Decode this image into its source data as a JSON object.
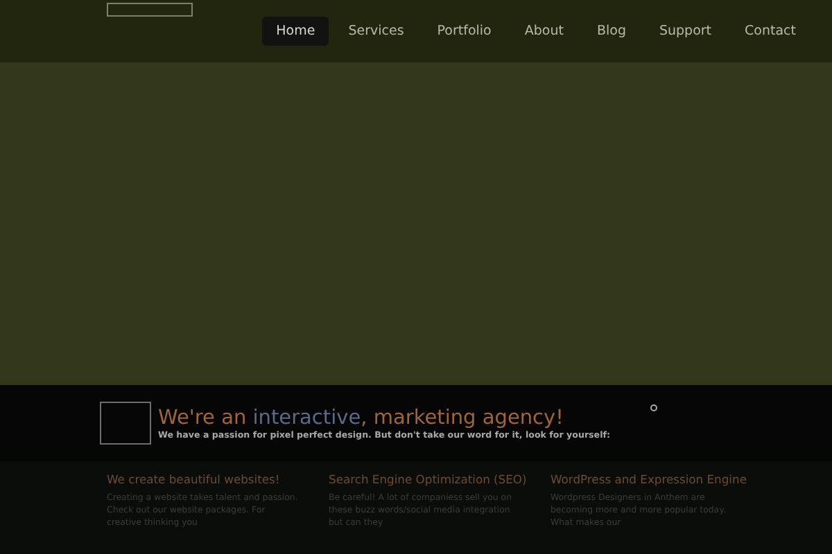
{
  "nav": [
    {
      "label": "Home",
      "selected": true
    },
    {
      "label": "Services",
      "selected": false
    },
    {
      "label": "Portfolio",
      "selected": false
    },
    {
      "label": "About",
      "selected": false
    },
    {
      "label": "Blog",
      "selected": false
    },
    {
      "label": "Support",
      "selected": false
    },
    {
      "label": "Contact",
      "selected": false
    }
  ],
  "banner": {
    "headline": {
      "before": "We're an ",
      "highlight": "interactive",
      "after": ", marketing agency!"
    },
    "tagline": "We have a passion for pixel perfect design. But don't take our word for it, look for yourself:"
  },
  "columns": [
    {
      "title": "We create beautiful websites!",
      "text": "Creating a website takes talent and passion. Check out our website packages. For creative thinking you"
    },
    {
      "title": "Search Engine Optimization (SEO)",
      "text": "Be careful! A lot of companiess sell you on these buzz words/social media integration but can they"
    },
    {
      "title": "WordPress and Expression Engine",
      "text": "Wordpress Designers in Anthem are becoming more and more popular today. What makes our"
    }
  ]
}
